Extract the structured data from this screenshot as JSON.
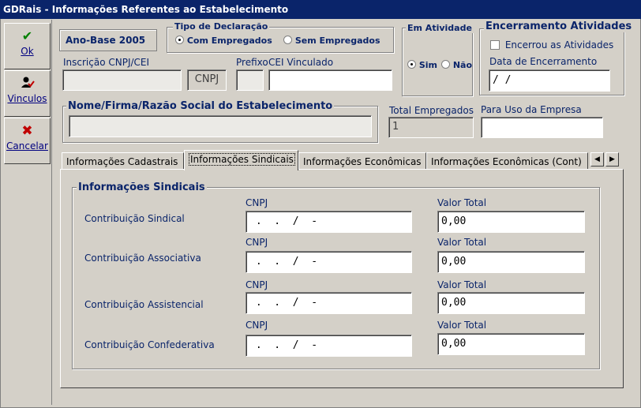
{
  "window": {
    "title": "GDRais - Informações Referentes ao Estabelecimento"
  },
  "side_buttons": {
    "ok": {
      "label": "Ok",
      "icon": "check-icon"
    },
    "vinculos": {
      "label": "Vinculos",
      "icon": "person-check-icon"
    },
    "cancelar": {
      "label": "Cancelar",
      "icon": "x-icon"
    }
  },
  "ano_base": "Ano-Base 2005",
  "tipo_declaracao": {
    "title": "Tipo de Declaração",
    "options": [
      "Com Empregados",
      "Sem Empregados"
    ],
    "selected": "Com Empregados"
  },
  "em_atividade": {
    "title": "Em Atividade",
    "options": [
      "Sim",
      "Não"
    ],
    "selected": "Sim"
  },
  "encerramento": {
    "title": "Encerramento Atividades",
    "checkbox_label": "Encerrou as Atividades",
    "checked": false,
    "date_label": "Data de Encerramento",
    "date_value": " / /"
  },
  "inscricao": {
    "label": "Inscrição CNPJ/CEI",
    "value": "",
    "type_value": "CNPJ"
  },
  "prefixo": {
    "label": "Prefixo",
    "value": ""
  },
  "cei_vinculado": {
    "label": "CEI Vinculado",
    "value": ""
  },
  "nome": {
    "label": "Nome/Firma/Razão Social do Estabelecimento",
    "value": ""
  },
  "total_empregados": {
    "label": "Total Empregados",
    "value": "1"
  },
  "uso_empresa": {
    "label": "Para Uso da Empresa",
    "value": ""
  },
  "tabs": [
    "Informações Cadastrais",
    "Informações Sindicais",
    "Informações Econômicas",
    "Informações Econômicas (Cont)"
  ],
  "active_tab": "Informações Sindicais",
  "sindicais": {
    "title": "Informações Sindicais",
    "cnpj_label": "CNPJ",
    "valor_label": "Valor Total",
    "rows": [
      {
        "label": "Contribuição Sindical",
        "cnpj": " .  .  /  -",
        "valor": "0,00"
      },
      {
        "label": "Contribuição Associativa",
        "cnpj": " .  .  /  -",
        "valor": "0,00"
      },
      {
        "label": "Contribuição Assistencial",
        "cnpj": " .  .  /  -",
        "valor": "0,00"
      },
      {
        "label": "Contribuição Confederativa",
        "cnpj": " .  .  /  -",
        "valor": "0,00"
      }
    ]
  }
}
